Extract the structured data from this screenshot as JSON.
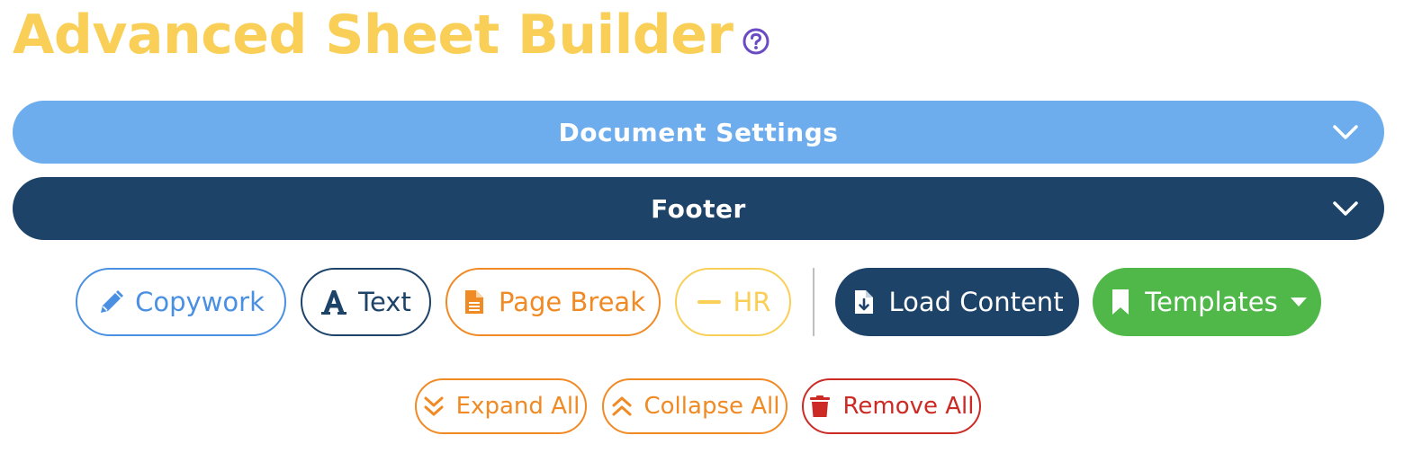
{
  "header": {
    "title": "Advanced Sheet Builder",
    "help_icon": "question-circle-icon"
  },
  "sections": [
    {
      "label": "Document Settings",
      "color": "#6daced",
      "icon": "chevron-down-icon"
    },
    {
      "label": "Footer",
      "color": "#1d4369",
      "icon": "chevron-down-icon"
    }
  ],
  "toolbar": {
    "copywork": {
      "label": "Copywork",
      "icon": "pencil-icon",
      "color": "#4a90e2"
    },
    "text": {
      "label": "Text",
      "icon": "text-a-icon",
      "color": "#1d4369"
    },
    "page_break": {
      "label": "Page Break",
      "icon": "file-icon",
      "color": "#f08a24"
    },
    "hr": {
      "label": "HR",
      "icon": "minus-icon",
      "color": "#f9cf57"
    },
    "load_content": {
      "label": "Load Content",
      "icon": "file-download-icon",
      "color": "#1d4369"
    },
    "templates": {
      "label": "Templates",
      "icon": "bookmark-icon",
      "color": "#4fb848"
    }
  },
  "actions": {
    "expand_all": {
      "label": "Expand All",
      "icon": "double-chevron-down-icon",
      "color": "#f08a24"
    },
    "collapse_all": {
      "label": "Collapse All",
      "icon": "double-chevron-up-icon",
      "color": "#f08a24"
    },
    "remove_all": {
      "label": "Remove All",
      "icon": "trash-icon",
      "color": "#cc2a24"
    }
  }
}
